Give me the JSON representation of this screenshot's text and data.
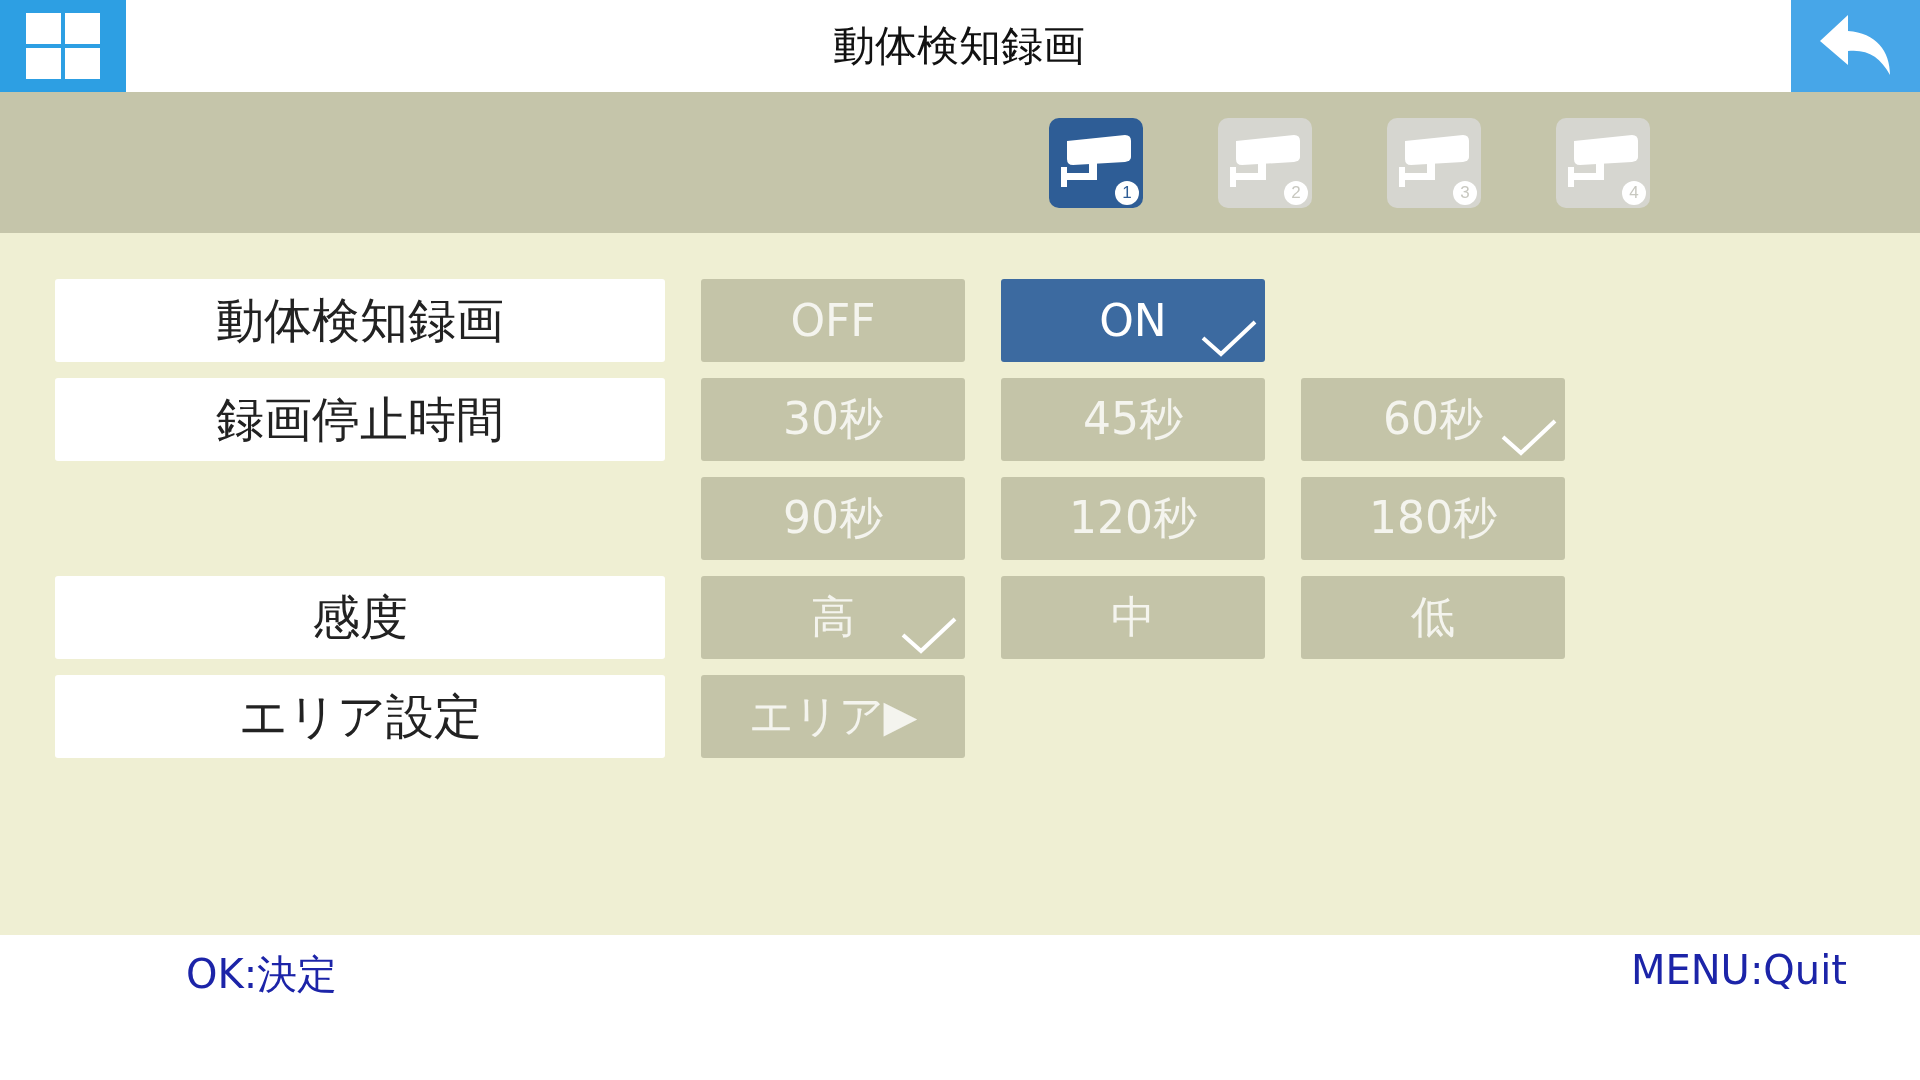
{
  "header": {
    "title": "動体検知録画"
  },
  "cameras": [
    {
      "number": "1",
      "selected": true
    },
    {
      "number": "2",
      "selected": false
    },
    {
      "number": "3",
      "selected": false
    },
    {
      "number": "4",
      "selected": false
    }
  ],
  "settings": [
    {
      "label": "動体検知録画",
      "options": [
        {
          "text": "OFF",
          "selected": false,
          "focused": false
        },
        {
          "text": "ON",
          "selected": true,
          "focused": true
        }
      ]
    },
    {
      "label": "録画停止時間",
      "options": [
        {
          "text": "30秒",
          "selected": false,
          "focused": false
        },
        {
          "text": "45秒",
          "selected": false,
          "focused": false
        },
        {
          "text": "60秒",
          "selected": true,
          "focused": false
        },
        {
          "text": "90秒",
          "selected": false,
          "focused": false
        },
        {
          "text": "120秒",
          "selected": false,
          "focused": false
        },
        {
          "text": "180秒",
          "selected": false,
          "focused": false
        }
      ]
    },
    {
      "label": "感度",
      "options": [
        {
          "text": "高",
          "selected": true,
          "focused": false
        },
        {
          "text": "中",
          "selected": false,
          "focused": false
        },
        {
          "text": "低",
          "selected": false,
          "focused": false
        }
      ]
    },
    {
      "label": "エリア設定",
      "options": [
        {
          "text": "エリア▶",
          "selected": false,
          "focused": false
        }
      ]
    }
  ],
  "footer": {
    "left": "OK:決定",
    "right": "MENU:Quit"
  }
}
